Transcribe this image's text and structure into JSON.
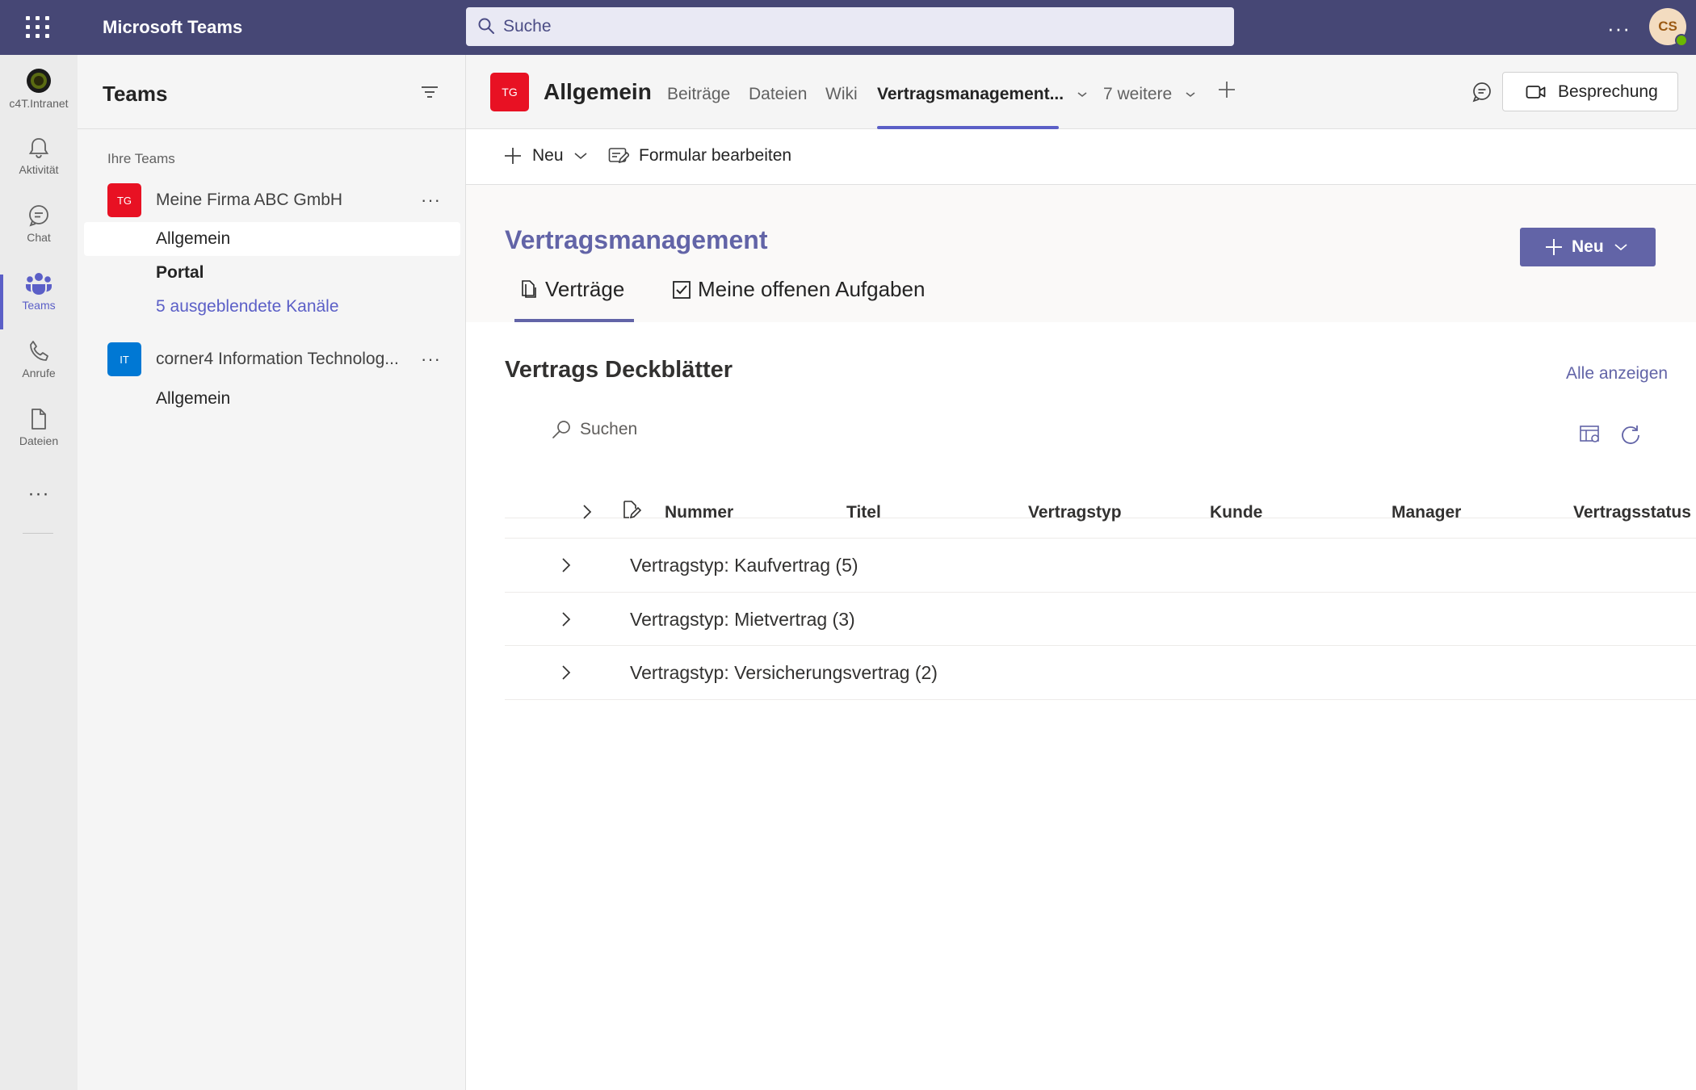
{
  "app": {
    "title": "Microsoft Teams",
    "heading": "Vertragsmanagement",
    "new_button": "Neu",
    "pivots": [
      "Verträge",
      "Meine offenen Aufgaben"
    ]
  },
  "topbar": {
    "search_placeholder": "Suche",
    "avatar_initials": "CS"
  },
  "rail": {
    "items": [
      {
        "label": "c4T.Intranet"
      },
      {
        "label": "Aktivität"
      },
      {
        "label": "Chat"
      },
      {
        "label": "Teams"
      },
      {
        "label": "Anrufe"
      },
      {
        "label": "Dateien"
      }
    ]
  },
  "teams_panel": {
    "title": "Teams",
    "section_label": "Ihre Teams",
    "teams": [
      {
        "initials": "TG",
        "name": "Meine Firma ABC GmbH",
        "color": "#e81123",
        "channels": [
          "Allgemein",
          "Portal",
          "5 ausgeblendete Kanäle"
        ]
      },
      {
        "initials": "IT",
        "name": "corner4 Information Technolog...",
        "color": "#0078d4",
        "channels": [
          "Allgemein"
        ]
      }
    ]
  },
  "channel_header": {
    "avatar_initials": "TG",
    "title": "Allgemein",
    "tabs": [
      "Beiträge",
      "Dateien",
      "Wiki",
      "Vertragsmanagement...",
      "7 weitere"
    ],
    "meeting_label": "Besprechung"
  },
  "commandbar": {
    "new_label": "Neu",
    "edit_form_label": "Formular bearbeiten"
  },
  "list": {
    "title": "Vertrags Deckblätter",
    "show_all": "Alle anzeigen",
    "search_placeholder": "Suchen",
    "columns": [
      "Nummer",
      "Titel",
      "Vertragstyp",
      "Kunde",
      "Manager",
      "Vertragsstatus"
    ],
    "groups": [
      "Vertragstyp: Kaufvertrag (5)",
      "Vertragstyp: Mietvertrag (3)",
      "Vertragstyp: Versicherungsvertrag (2)"
    ]
  },
  "colors": {
    "brand": "#464775",
    "accent": "#5b5fc7",
    "app_accent": "#6264a7"
  }
}
